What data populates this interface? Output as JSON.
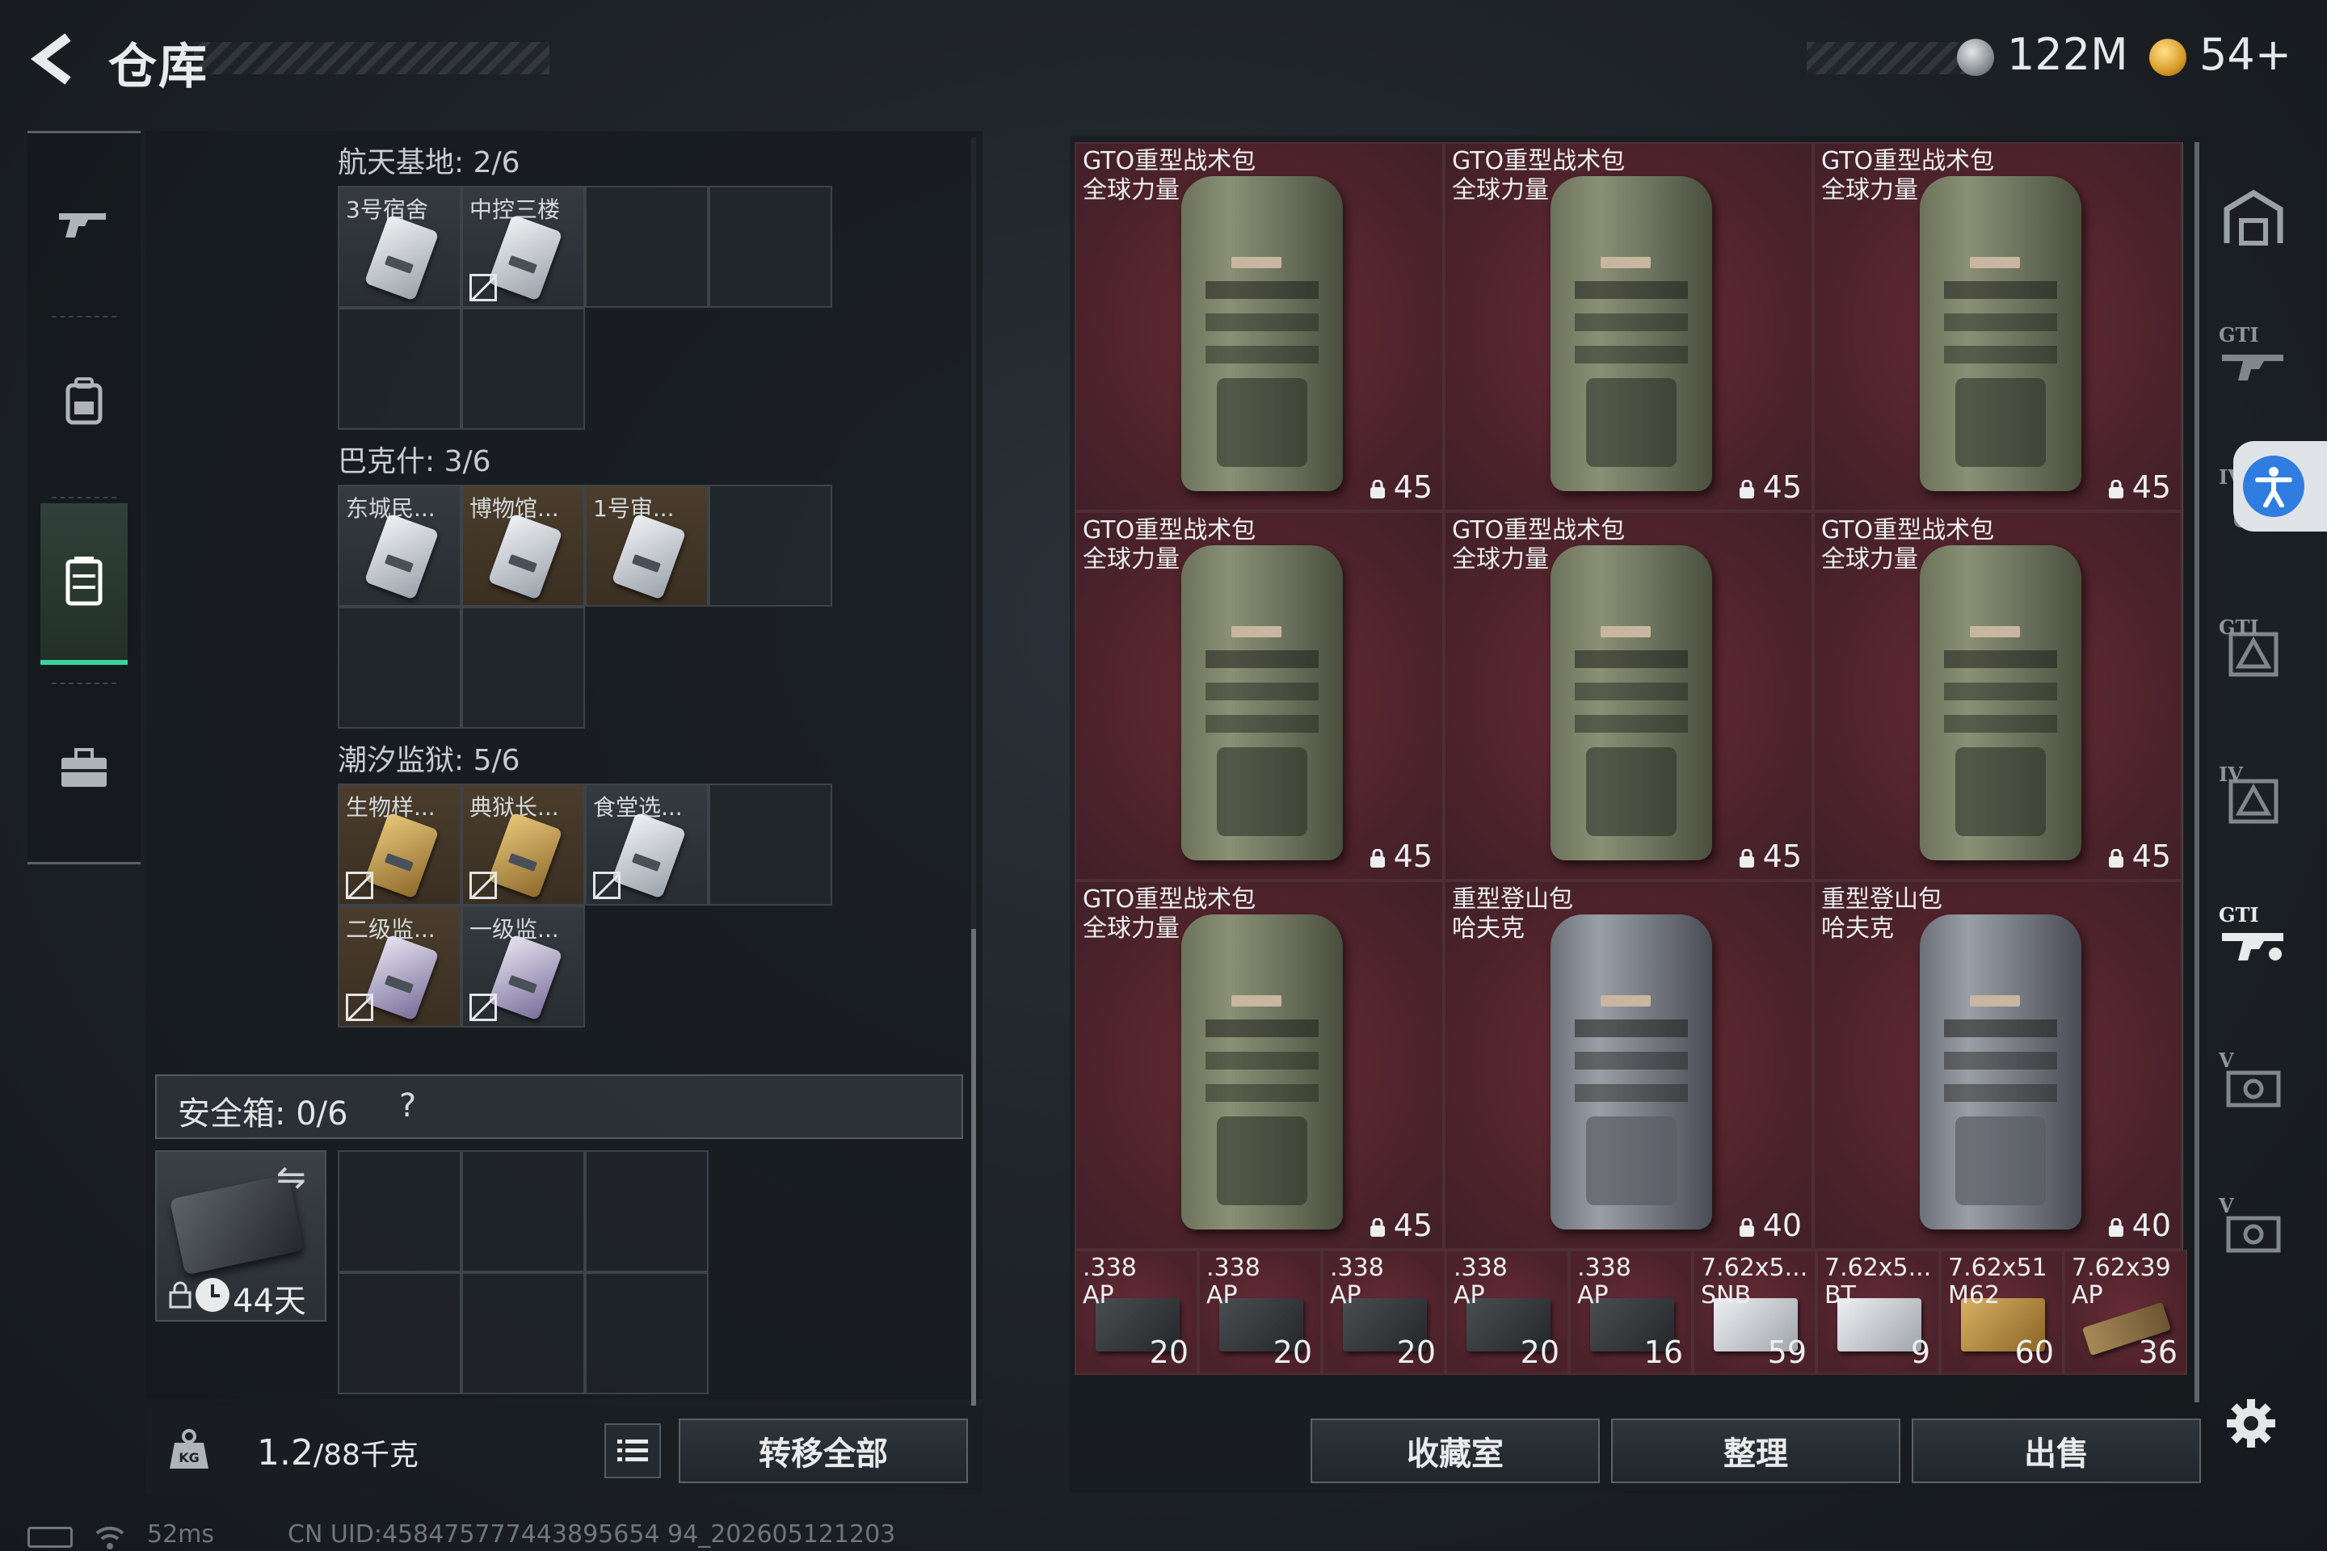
{
  "header": {
    "title": "仓库",
    "currencies": [
      {
        "name": "money-icon",
        "value": "122M"
      },
      {
        "name": "coin-icon",
        "value": "54+"
      }
    ]
  },
  "left_nav": {
    "items": [
      {
        "icon": "rifle-icon",
        "active": false
      },
      {
        "icon": "backpack-icon",
        "active": false
      },
      {
        "icon": "vest-icon",
        "active": true
      },
      {
        "icon": "toolbox-icon",
        "active": false
      }
    ],
    "accent_color": "#3bd49a"
  },
  "keys": {
    "groups": [
      {
        "title": "航天基地: 2/6",
        "items": [
          {
            "label": "3号宿舍",
            "card": "white",
            "no_store": false
          },
          {
            "label": "中控三楼",
            "card": "white",
            "no_store": true
          }
        ]
      },
      {
        "title": "巴克什: 3/6",
        "items": [
          {
            "label": "东城民...",
            "card": "white",
            "no_store": false
          },
          {
            "label": "博物馆...",
            "card": "white",
            "no_store": false
          },
          {
            "label": "1号审...",
            "card": "white",
            "no_store": false
          }
        ]
      },
      {
        "title": "潮汐监狱: 5/6",
        "items": [
          {
            "label": "生物样...",
            "card": "gold",
            "no_store": true
          },
          {
            "label": "典狱长...",
            "card": "gold",
            "no_store": true
          },
          {
            "label": "食堂选...",
            "card": "white",
            "no_store": true
          },
          {
            "label": "二级监...",
            "card": "purple",
            "no_store": true
          },
          {
            "label": "一级监...",
            "card": "purple",
            "no_store": true
          }
        ]
      }
    ]
  },
  "safe_box": {
    "label": "安全箱: 0/6",
    "help": "?",
    "days": "44天"
  },
  "weight": {
    "current": "1.2",
    "max": "/88千克"
  },
  "buttons": {
    "transfer_all": "转移全部",
    "collection": "收藏室",
    "sort": "整理",
    "sell": "出售"
  },
  "stash": {
    "bags": [
      {
        "line1": "GTO重型战术包",
        "line2": "全球力量",
        "capacity": "45",
        "color": "green"
      },
      {
        "line1": "GTO重型战术包",
        "line2": "全球力量",
        "capacity": "45",
        "color": "green"
      },
      {
        "line1": "GTO重型战术包",
        "line2": "全球力量",
        "capacity": "45",
        "color": "green"
      },
      {
        "line1": "GTO重型战术包",
        "line2": "全球力量",
        "capacity": "45",
        "color": "green"
      },
      {
        "line1": "GTO重型战术包",
        "line2": "全球力量",
        "capacity": "45",
        "color": "green"
      },
      {
        "line1": "GTO重型战术包",
        "line2": "全球力量",
        "capacity": "45",
        "color": "green"
      },
      {
        "line1": "GTO重型战术包",
        "line2": "全球力量",
        "capacity": "45",
        "color": "green"
      },
      {
        "line1": "重型登山包",
        "line2": "哈夫克",
        "capacity": "40",
        "color": "blue"
      },
      {
        "line1": "重型登山包",
        "line2": "哈夫克",
        "capacity": "40",
        "color": "blue"
      }
    ],
    "ammo": [
      {
        "line1": ".338",
        "line2": "AP",
        "count": "20",
        "box": "dark"
      },
      {
        "line1": ".338",
        "line2": "AP",
        "count": "20",
        "box": "dark"
      },
      {
        "line1": ".338",
        "line2": "AP",
        "count": "20",
        "box": "dark"
      },
      {
        "line1": ".338",
        "line2": "AP",
        "count": "20",
        "box": "dark"
      },
      {
        "line1": ".338",
        "line2": "AP",
        "count": "16",
        "box": "dark"
      },
      {
        "line1": "7.62x5...",
        "line2": "SNB",
        "count": "59",
        "box": "white"
      },
      {
        "line1": "7.62x5...",
        "line2": "BT",
        "count": "9",
        "box": "white"
      },
      {
        "line1": "7.62x51",
        "line2": "M62",
        "count": "60",
        "box": "yellow"
      },
      {
        "line1": "7.62x39",
        "line2": "AP",
        "count": "36",
        "box": "cartridge"
      }
    ],
    "cell_color": "#672c36"
  },
  "right_sidebar": {
    "items": [
      {
        "icon": "warehouse-icon",
        "tier": ""
      },
      {
        "icon": "gti-rifle-icon",
        "tier": "GTI"
      },
      {
        "icon": "tier-iv-vest-icon",
        "tier": "IV"
      },
      {
        "icon": "gti-armor-icon",
        "tier": "GTI"
      },
      {
        "icon": "tier-iv-armor-icon",
        "tier": "IV"
      },
      {
        "icon": "gti-weapon-active-icon",
        "tier": "GTI"
      },
      {
        "icon": "tier-v-item-icon",
        "tier": "V"
      },
      {
        "icon": "tier-v-item-2-icon",
        "tier": "V"
      }
    ]
  },
  "status": {
    "ping": "52ms",
    "uid": "CN UID:458475777443895654 94_202605121203"
  }
}
